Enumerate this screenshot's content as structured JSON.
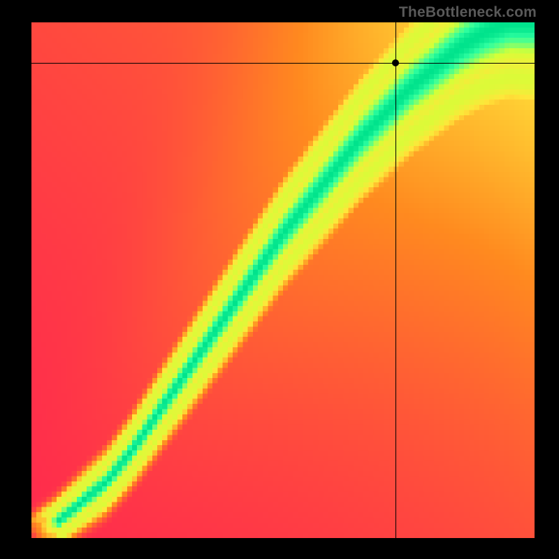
{
  "watermark": "TheBottleneck.com",
  "chart_data": {
    "type": "heatmap",
    "title": "",
    "xlabel": "",
    "ylabel": "",
    "xlim": [
      0,
      100
    ],
    "ylim": [
      0,
      100
    ],
    "grid_resolution": 100,
    "color_stops": [
      {
        "t": 0.0,
        "hex": "#ff2a4d"
      },
      {
        "t": 0.35,
        "hex": "#ff8a1f"
      },
      {
        "t": 0.6,
        "hex": "#ffe63a"
      },
      {
        "t": 0.82,
        "hex": "#d4ff38"
      },
      {
        "t": 0.95,
        "hex": "#2effa0"
      },
      {
        "t": 1.0,
        "hex": "#00e38c"
      }
    ],
    "ridge_points": [
      {
        "x": 0,
        "y": 0
      },
      {
        "x": 5,
        "y": 3
      },
      {
        "x": 10,
        "y": 7
      },
      {
        "x": 15,
        "y": 11
      },
      {
        "x": 20,
        "y": 17
      },
      {
        "x": 25,
        "y": 24
      },
      {
        "x": 30,
        "y": 31
      },
      {
        "x": 35,
        "y": 38
      },
      {
        "x": 40,
        "y": 45
      },
      {
        "x": 45,
        "y": 52
      },
      {
        "x": 50,
        "y": 59
      },
      {
        "x": 55,
        "y": 65
      },
      {
        "x": 60,
        "y": 71
      },
      {
        "x": 65,
        "y": 77
      },
      {
        "x": 70,
        "y": 82
      },
      {
        "x": 75,
        "y": 87
      },
      {
        "x": 80,
        "y": 91
      },
      {
        "x": 85,
        "y": 95
      },
      {
        "x": 90,
        "y": 98
      },
      {
        "x": 95,
        "y": 100
      },
      {
        "x": 100,
        "y": 100
      }
    ],
    "ridge_width_base": 2.2,
    "ridge_width_scale": 7.0,
    "background_gradient_angle_deg": 45,
    "marker": {
      "x": 72.3,
      "y": 92.2
    }
  }
}
